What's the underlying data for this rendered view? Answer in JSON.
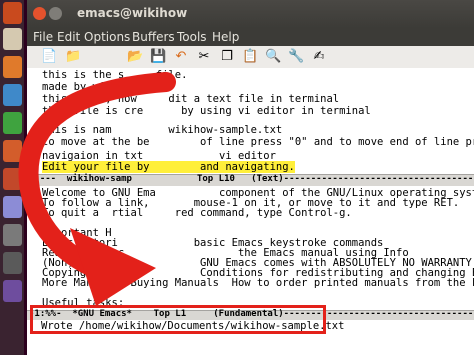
{
  "window": {
    "title": "emacs@wikihow"
  },
  "menubar": {
    "items": [
      "File",
      "Edit",
      "Options",
      "Buffers",
      "Tools",
      "Help"
    ]
  },
  "buffer_top": {
    "lines": [
      "this is the s     file.",
      "made by wikiho",
      "this shows, how     dit a text file in terminal",
      "this file is cre      by using vi editor in terminal",
      "",
      "this is nam         wikihow-sample.txt",
      "to move at the be        of line press \"0\" and to move end of line press \"$\"",
      "",
      "navigaion in txt            vi editor"
    ],
    "highlight_line": "Edit your file by        and navigating."
  },
  "modeline_top": {
    "text": "-:---  wikihow-samp            Top L10   (Text)--------------------------------------"
  },
  "buffer_bottom": {
    "lines": [
      "Welcome to GNU Ema          component of the GNU/Linux operating system.",
      "To follow a link,       mouse-1 on it, or move to it and type RET.",
      "To quit a  rtial     red command, type Control-g.",
      "",
      "Important H",
      "Emacs Tutori            basic Emacs keystroke commands",
      "Read the Emac                  the Emacs manual using Info",
      "(Non)Warranty            GNU Emacs comes with ABSOLUTELY NO WARRANTY",
      "Copying Condi            Conditions for redistributing and changing Emacs",
      "More Manuals  Buying Manuals  How to order printed manuals from the FSF",
      "",
      "Useful tasks:"
    ]
  },
  "modeline_bottom": {
    "text": "-1:%%-  *GNU Emacs*    Top L1     (Fundamental)-------------------------------------"
  },
  "echo_area": {
    "text": "Wrote /home/wikihow/Documents/wikihow-sample.txt"
  },
  "colors": {
    "annotation_red": "#e3211a",
    "highlight": "#ffef3a"
  }
}
